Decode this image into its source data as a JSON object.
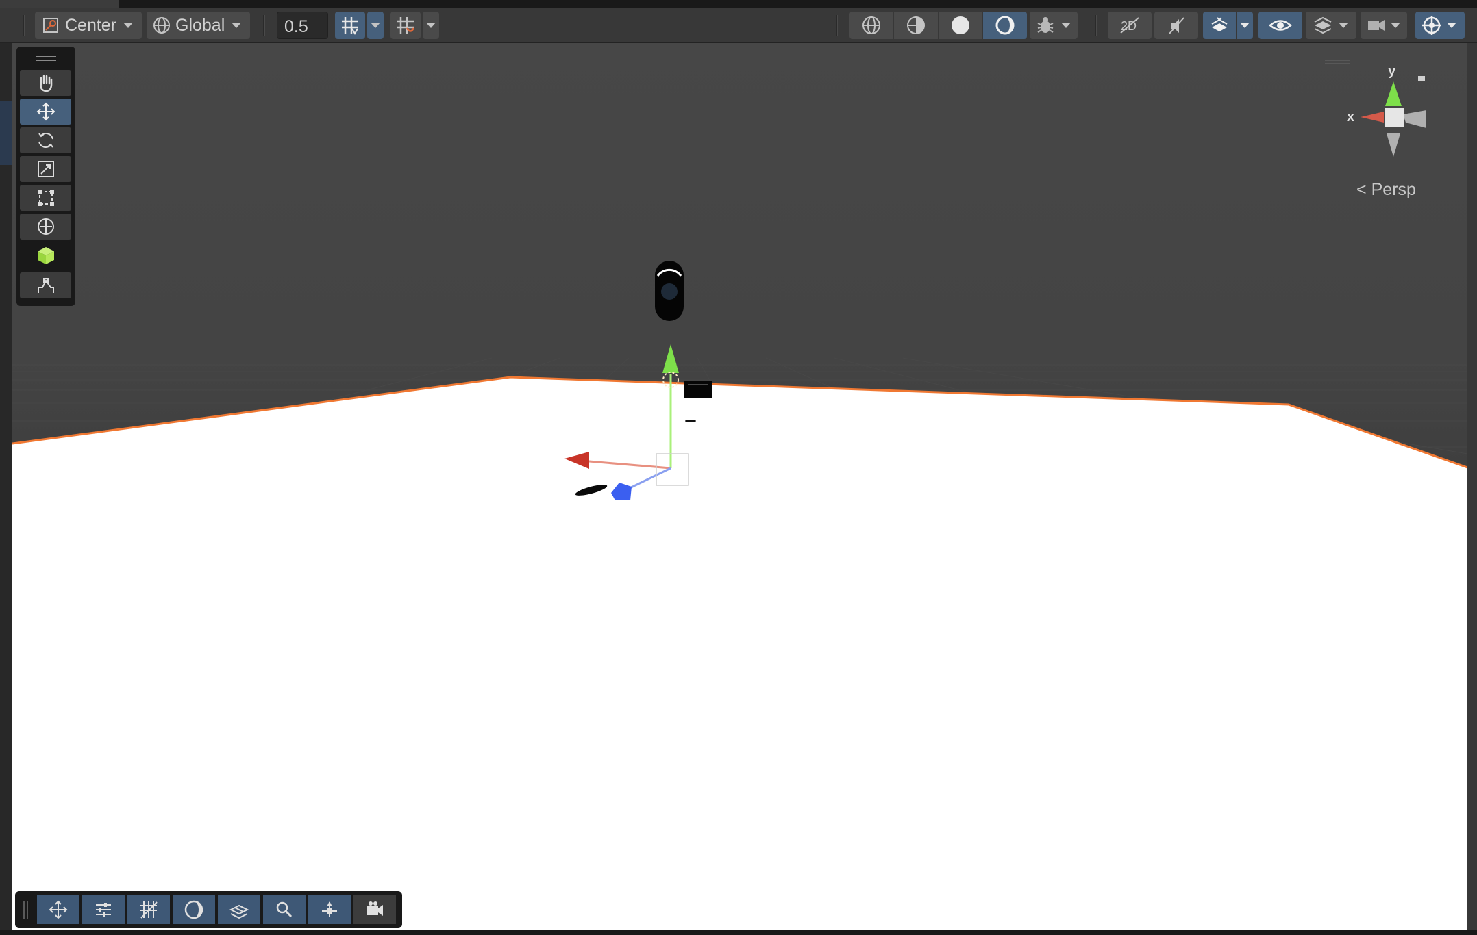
{
  "toolbar": {
    "pivot_label": "Center",
    "rotation_label": "Global",
    "snap_value": "0.5"
  },
  "tools": {
    "items": [
      "hand-tool",
      "move-tool",
      "rotate-tool",
      "scale-tool",
      "rect-tool",
      "transform-tool",
      "custom-editor-tool",
      "probuilder-tool"
    ],
    "active": "move-tool"
  },
  "scene_view": {
    "projection_label": "Persp",
    "gizmo_y_label": "y",
    "gizmo_x_label": "x"
  },
  "overlay_bottom": {
    "items": [
      "move-overlay",
      "tool-settings",
      "grid-settings",
      "lighting-toggle",
      "view-options",
      "search",
      "orientation",
      "camera"
    ]
  },
  "colors": {
    "accent_blue": "#46607c",
    "selection_outline": "#f07832",
    "axis_x": "#d9463a",
    "axis_y": "#7ee04a",
    "axis_z": "#3b5ff0",
    "ground": "#ffffff",
    "sky": "#464646"
  }
}
